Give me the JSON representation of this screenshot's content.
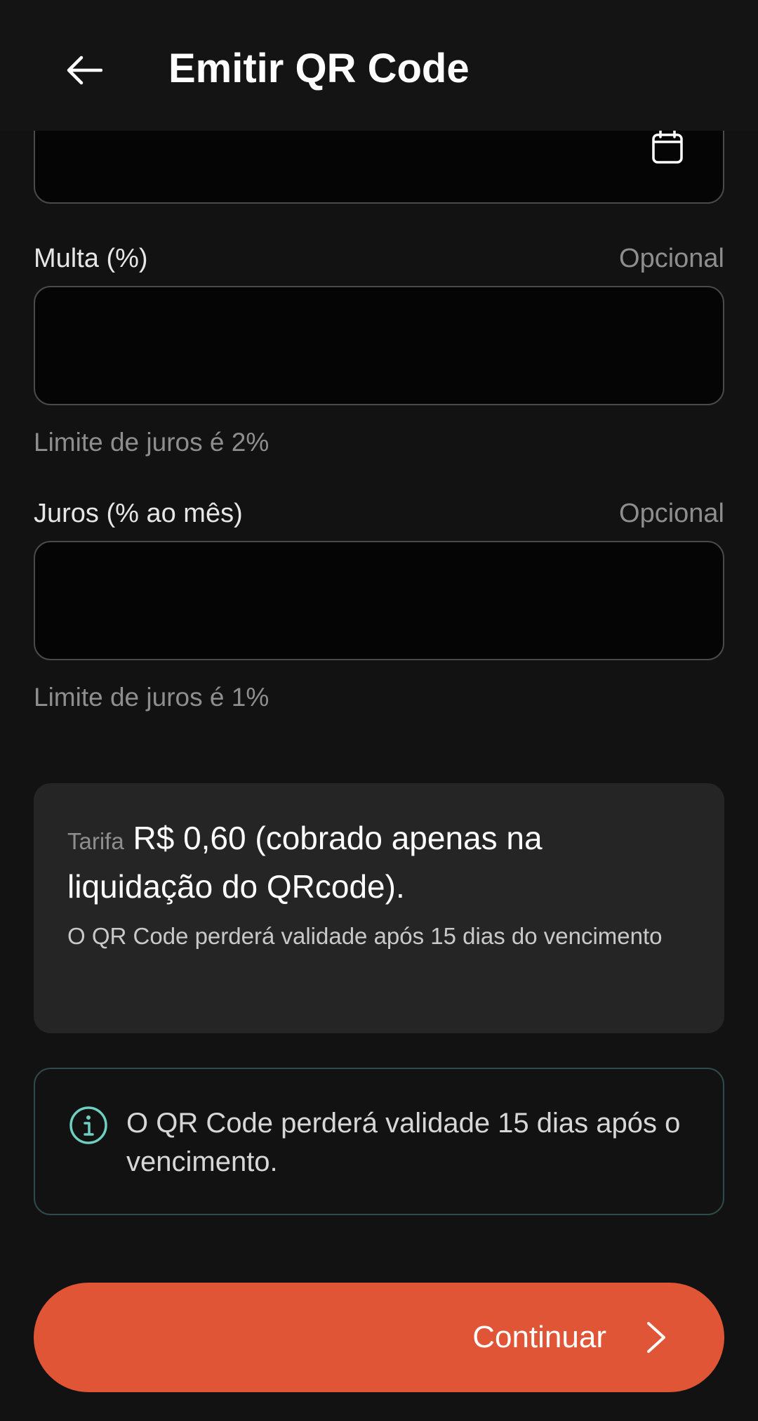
{
  "header": {
    "title": "Emitir QR Code",
    "back_icon": "arrow-left-icon"
  },
  "date_field": {
    "icon": "calendar-icon"
  },
  "fields": {
    "multa": {
      "label": "Multa (%)",
      "optional": "Opcional",
      "value": "",
      "hint": "Limite de juros é 2%"
    },
    "juros": {
      "label": "Juros (% ao mês)",
      "optional": "Opcional",
      "value": "",
      "hint": "Limite de juros é 1%"
    }
  },
  "fee_card": {
    "label": "Tarifa",
    "main": "R$ 0,60 (cobrado apenas na liquidação do QRcode).",
    "note": "O QR Code perderá validade após 15 dias do vencimento"
  },
  "info_box": {
    "icon": "info-icon",
    "text": "O QR Code perderá validade 15 dias após o vencimento."
  },
  "continue_button": {
    "label": "Continuar",
    "icon": "chevron-right-icon"
  },
  "colors": {
    "background": "#121212",
    "accent": "#e05535",
    "info_accent": "#6fcfc2",
    "card": "#252525"
  }
}
